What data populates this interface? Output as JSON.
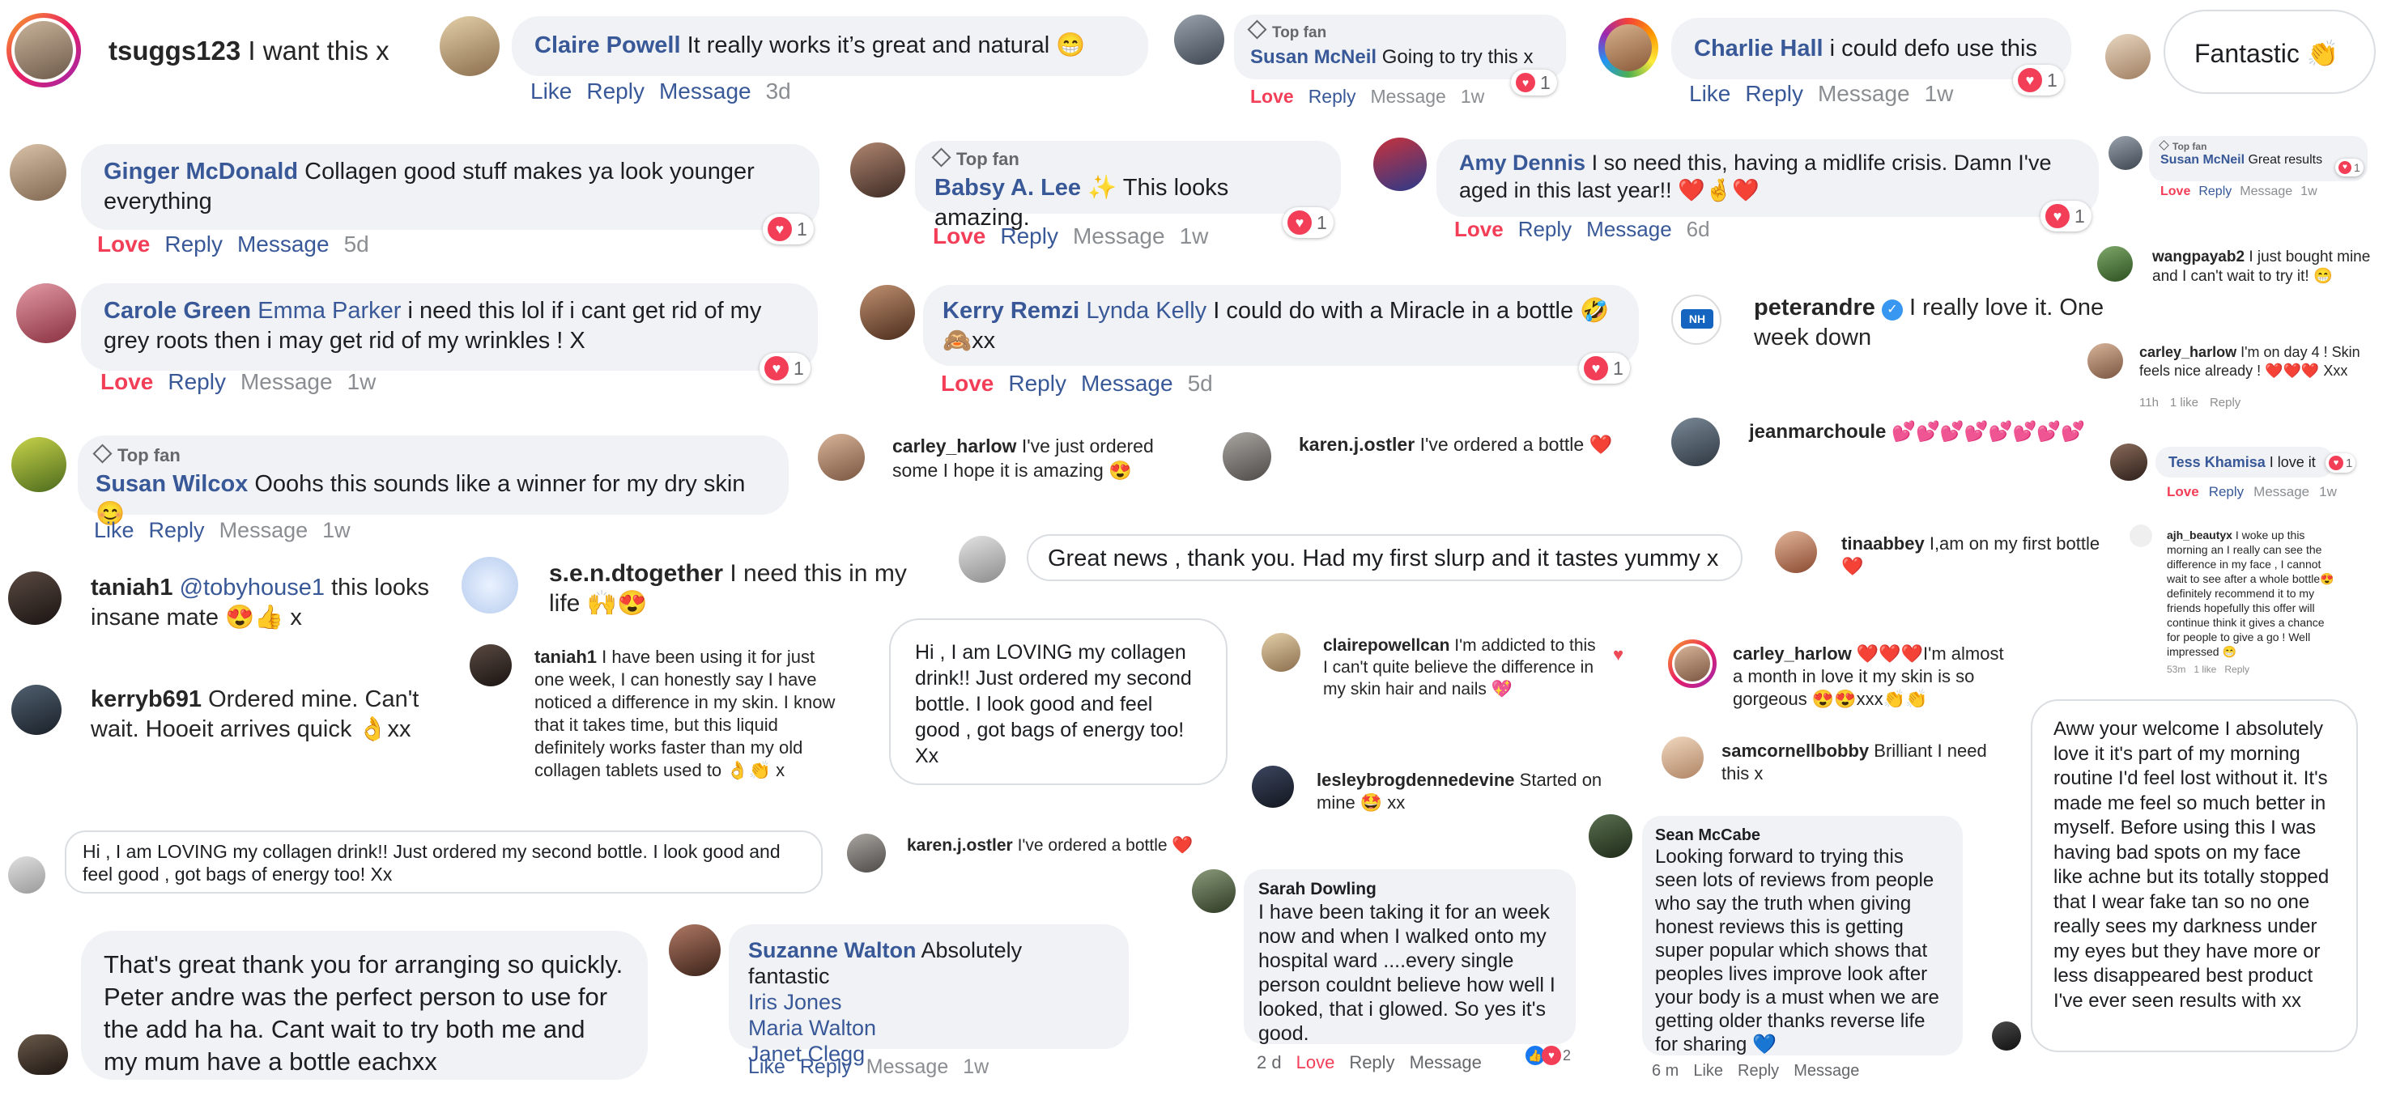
{
  "colors": {
    "facebook_name": "#385898",
    "love": "#f33e58",
    "bubble": "#f0f2f5",
    "muted": "#65676b"
  },
  "c1": {
    "user": "tsuggs123",
    "text": "I want this x"
  },
  "c2": {
    "user": "Claire Powell",
    "text": "It really works it’s great and natural 😁",
    "like": "Like",
    "reply": "Reply",
    "message": "Message",
    "time": "3d"
  },
  "c3": {
    "badge": "Top fan",
    "user": "Susan McNeil",
    "text": "Going to try this x",
    "love": "Love",
    "reply": "Reply",
    "message": "Message",
    "time": "1w",
    "count": "1"
  },
  "c4": {
    "user": "Charlie Hall",
    "text": "i could defo use this",
    "like": "Like",
    "reply": "Reply",
    "message": "Message",
    "time": "1w",
    "count": "1"
  },
  "c5": {
    "text": "Fantastic 👏"
  },
  "c6": {
    "user": "Ginger McDonald",
    "text": "Collagen good stuff makes ya look younger everything",
    "love": "Love",
    "reply": "Reply",
    "message": "Message",
    "time": "5d",
    "count": "1"
  },
  "c7": {
    "badge": "Top fan",
    "user": "Babsy A. Lee",
    "text": "✨ This looks amazing.",
    "love": "Love",
    "reply": "Reply",
    "message": "Message",
    "time": "1w",
    "count": "1"
  },
  "c8": {
    "user": "Amy Dennis",
    "text": "I so need this, having a midlife crisis. Damn I've aged in this last year!! ❤️🤞❤️",
    "love": "Love",
    "reply": "Reply",
    "message": "Message",
    "time": "6d",
    "count": "1"
  },
  "c9": {
    "badge": "Top fan",
    "user": "Susan McNeil",
    "text": "Great results",
    "love": "Love",
    "reply": "Reply",
    "message": "Message",
    "time": "1w",
    "count": "1"
  },
  "c10": {
    "user": "wangpayab2",
    "text": "I just bought mine and I can't wait to try it! 😁"
  },
  "c11": {
    "user": "Carole Green",
    "tag": "Emma Parker",
    "text": "i need this lol if i cant get rid of my grey roots then i may get rid of my wrinkles ! X",
    "love": "Love",
    "reply": "Reply",
    "message": "Message",
    "time": "1w",
    "count": "1"
  },
  "c12": {
    "user": "Kerry Remzi",
    "tag": "Lynda Kelly",
    "text": "I could do with a Miracle in a bottle 🤣🙈xx",
    "love": "Love",
    "reply": "Reply",
    "message": "Message",
    "time": "5d",
    "count": "1"
  },
  "c13": {
    "user": "peterandre",
    "text": "I really love it. One week down",
    "avatar": "NH"
  },
  "c14": {
    "user": "carley_harlow",
    "text": "I'm on day 4 ! Skin feels nice already ! ❤️❤️❤️ Xxx",
    "time": "11h",
    "likes": "1 like",
    "reply": "Reply"
  },
  "c15": {
    "badge": "Top fan",
    "user": "Susan Wilcox",
    "text": "Ooohs this sounds like a winner for my dry skin 😊",
    "like": "Like",
    "reply": "Reply",
    "message": "Message",
    "time": "1w"
  },
  "c16": {
    "user": "carley_harlow",
    "text": "I've just ordered some I hope it is amazing 😍"
  },
  "c17": {
    "user": "karen.j.ostler",
    "text": "I've ordered a bottle ❤️"
  },
  "c18": {
    "user": "jeanmarchoule",
    "text": "💕💕💕💕💕💕💕💕"
  },
  "c19": {
    "user": "Tess Khamisa",
    "text": "I love it",
    "love": "Love",
    "reply": "Reply",
    "message": "Message",
    "time": "1w",
    "count": "1"
  },
  "c20": {
    "user": "taniah1",
    "tag": "@tobyhouse1",
    "text": "this looks insane mate 😍👍 x"
  },
  "c21": {
    "user": "s.e.n.dtogether",
    "text": "I need this in my life 🙌😍"
  },
  "c22": {
    "text": "Great news , thank you. Had my first slurp and it tastes yummy x"
  },
  "c23": {
    "user": "tinaabbey",
    "text": "I,am on my first bottle ❤️"
  },
  "c24": {
    "user": "ajh_beautyx",
    "text": "I woke up this morning an I really can see the difference in my face , I cannot wait to see after a whole bottle😍 definitely recommend it to my friends hopefully this offer will continue think it gives a chance for people to give a go ! Well impressed 😁",
    "time": "53m",
    "likes": "1 like",
    "reply": "Reply"
  },
  "c25": {
    "user": "kerryb691",
    "text": "Ordered mine. Can't wait. Hooeit arrives quick 👌xx"
  },
  "c26": {
    "user": "taniah1",
    "text": "I have been using it for just one week, I can honestly say I have noticed a difference in my skin. I know that it takes time, but this liquid definitely works faster than my old collagen tablets used to 👌👏 x"
  },
  "c27": {
    "text": "Hi , I am LOVING my collagen drink!! Just ordered my second bottle. I look good and feel good , got bags of energy too! Xx"
  },
  "c28": {
    "user": "clairepowellcan",
    "text": "I'm addicted to this I can't quite believe the difference in my skin hair and nails 💖"
  },
  "c29": {
    "user": "carley_harlow",
    "text": "❤️❤️❤️I'm almost a month in love it my skin is so gorgeous 😍😍xxx👏👏"
  },
  "c30": {
    "user": "lesleybrogdennedevine",
    "text": "Started on mine 🤩 xx"
  },
  "c31": {
    "user": "samcornellbobby",
    "text": "Brilliant I need this x"
  },
  "c32": {
    "text": "Aww your welcome I absolutely love it it's part of my morning routine I'd feel lost without it. It's made me feel so much better in myself. Before using this I was having bad spots on my face like achne but its totally stopped that I wear fake tan so no one really sees my darkness under my eyes but they have more or less disappeared best product I've ever seen results with xx"
  },
  "c33": {
    "text": "Hi , I am LOVING my collagen drink!! Just ordered my second bottle. I look good and feel good , got bags of energy too! Xx"
  },
  "c34": {
    "user": "karen.j.ostler",
    "text": "I've ordered a bottle ❤️"
  },
  "c35": {
    "user": "Sean McCabe",
    "text": "Looking forward to trying this seen lots of reviews from people who say the truth when giving honest reviews this is getting super popular which shows that peoples lives improve look after your body is a must when we are getting older thanks reverse life for sharing 💙",
    "time": "6 m",
    "like": "Like",
    "reply": "Reply",
    "message": "Message"
  },
  "c36": {
    "text": "That's great thank you for arranging so quickly. Peter andre was the perfect person to use for the add ha ha. Cant wait to try both me and my mum have a bottle eachxx"
  },
  "c37": {
    "user": "Suzanne Walton",
    "text": "Absolutely fantastic",
    "tags": [
      "Iris Jones",
      "Maria Walton",
      "Janet Clegg"
    ],
    "like": "Like",
    "reply": "Reply",
    "message": "Message",
    "time": "1w"
  },
  "c38": {
    "user": "Sarah Dowling",
    "text": "I have been taking it for an week now and when I walked onto my hospital ward ....every single person couldnt believe how well I looked, that i glowed. So yes it's good.",
    "time": "2 d",
    "love": "Love",
    "reply": "Reply",
    "message": "Message",
    "count": "2"
  }
}
